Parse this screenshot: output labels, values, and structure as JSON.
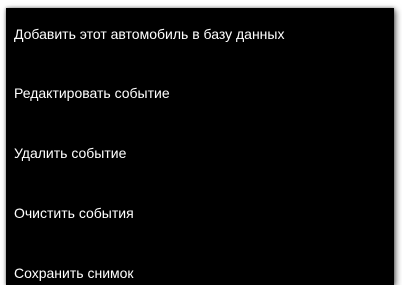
{
  "context_menu": {
    "items": [
      {
        "label": "Добавить этот автомобиль в базу данных"
      },
      {
        "label": "Редактировать событие"
      },
      {
        "label": "Удалить событие"
      },
      {
        "label": "Очистить события"
      },
      {
        "label": "Сохранить снимок"
      }
    ],
    "colors": {
      "background": "#000000",
      "text": "#ffffff"
    }
  }
}
